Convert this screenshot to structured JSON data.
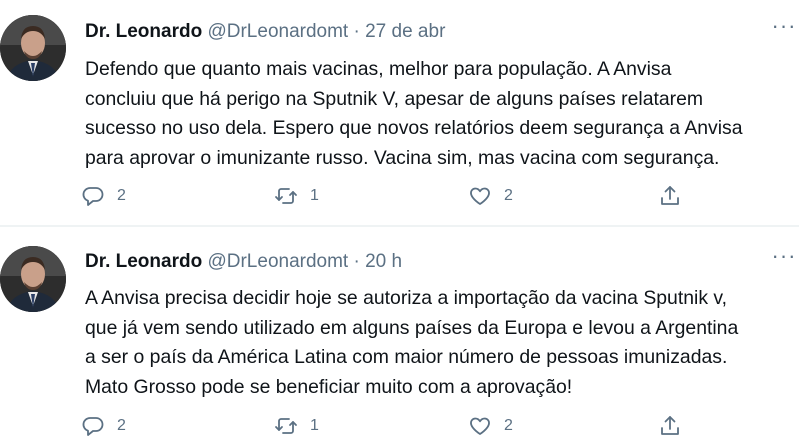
{
  "tweets": [
    {
      "author_name": "Dr. Leonardo",
      "handle": "@DrLeonardomt",
      "separator": "·",
      "time": "27 de abr",
      "more": "···",
      "text": "Defendo que quanto mais vacinas, melhor para população. A Anvisa\nconcluiu que há perigo na Sputnik V, apesar de alguns países relatarem\nsucesso no uso dela. Espero que novos relatórios deem segurança a Anvisa\npara aprovar o imunizante russo. Vacina sim, mas vacina com segurança.",
      "replies": "2",
      "retweets": "1",
      "likes": "2"
    },
    {
      "author_name": "Dr. Leonardo",
      "handle": "@DrLeonardomt",
      "separator": "·",
      "time": "20 h",
      "more": "···",
      "text": "A Anvisa precisa decidir hoje se autoriza a importação da vacina Sputnik v,\nque já vem sendo utilizado em alguns países da Europa e levou a Argentina\na ser o país da América Latina com maior número de pessoas imunizadas.\nMato Grosso pode se beneficiar muito com a aprovação!",
      "replies": "2",
      "retweets": "1",
      "likes": "2"
    }
  ],
  "icons": {
    "reply": "reply-icon",
    "retweet": "retweet-icon",
    "like": "like-icon",
    "share": "share-icon",
    "more": "more-icon"
  },
  "colors": {
    "secondary_text": "#5b7083",
    "primary_text": "#0f1419",
    "divider": "#eff3f4"
  }
}
